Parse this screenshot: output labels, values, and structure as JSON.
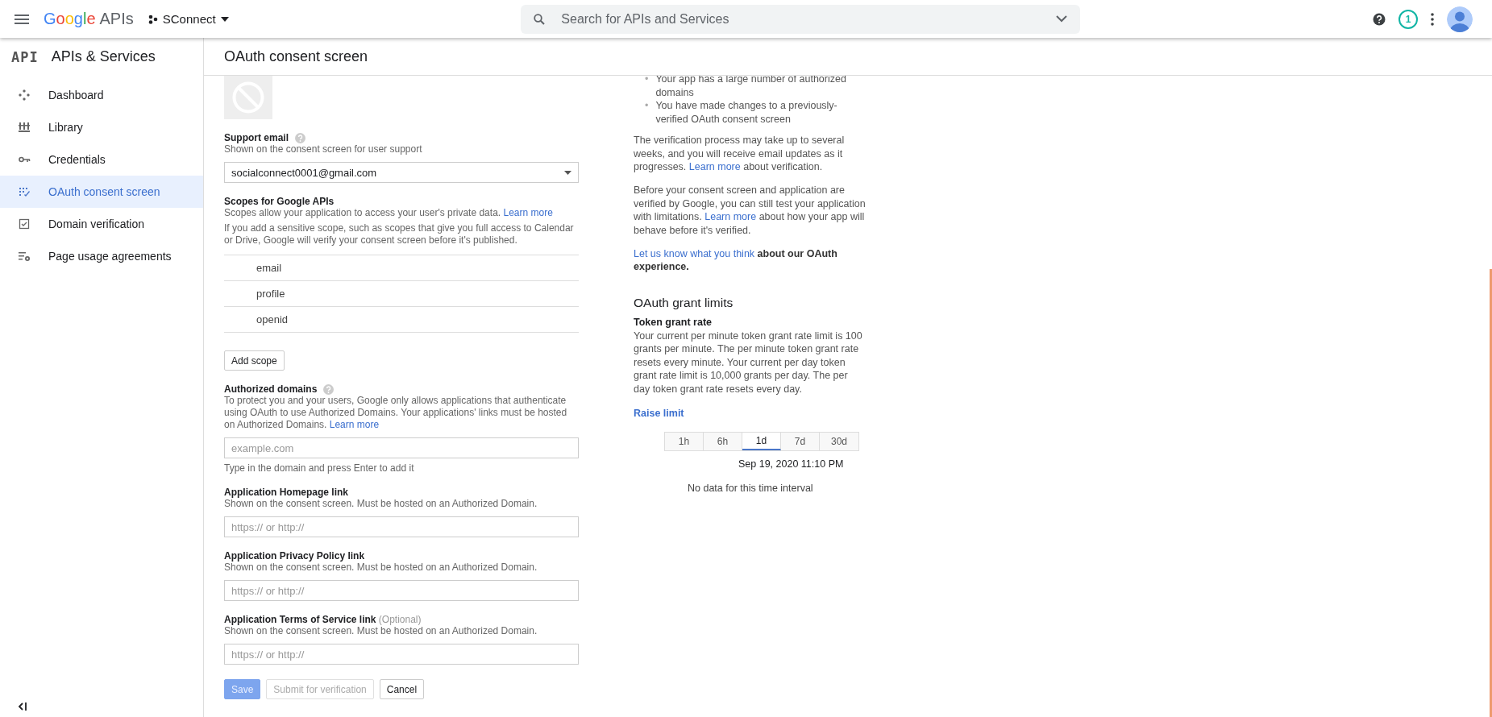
{
  "topbar": {
    "brand": "Google",
    "product": "APIs",
    "project": "SConnect",
    "search": {
      "placeholder": "Search for APIs and Services"
    },
    "notification_count": "1"
  },
  "sidebar": {
    "logo": "API",
    "title": "APIs & Services",
    "items": [
      {
        "label": "Dashboard",
        "selected": false
      },
      {
        "label": "Library",
        "selected": false
      },
      {
        "label": "Credentials",
        "selected": false
      },
      {
        "label": "OAuth consent screen",
        "selected": true
      },
      {
        "label": "Domain verification",
        "selected": false
      },
      {
        "label": "Page usage agreements",
        "selected": false
      }
    ]
  },
  "page_title": "OAuth consent screen",
  "form": {
    "support_email": {
      "label": "Support email",
      "description": "Shown on the consent screen for user support",
      "value": "socialconnect0001@gmail.com"
    },
    "scopes": {
      "title": "Scopes for Google APIs",
      "description": "Scopes allow your application to access your user's private data.",
      "link": "Learn more",
      "note": "If you add a sensitive scope, such as scopes that give you full access to Calendar or Drive, Google will verify your consent screen before it's published.",
      "items": [
        "email",
        "profile",
        "openid"
      ],
      "add_button": "Add scope"
    },
    "authorized_domains": {
      "title": "Authorized domains",
      "description": "To protect you and your users, Google only allows applications that authenticate using OAuth to use Authorized Domains. Your applications' links must be hosted on Authorized Domains.",
      "link": "Learn more",
      "placeholder": "example.com",
      "hint": "Type in the domain and press Enter to add it"
    },
    "links": [
      {
        "label": "Application Homepage link",
        "description": "Shown on the consent screen. Must be hosted on an Authorized Domain.",
        "placeholder": "https:// or http://"
      },
      {
        "label": "Application Privacy Policy link",
        "description": "Shown on the consent screen. Must be hosted on an Authorized Domain.",
        "placeholder": "https:// or http://"
      },
      {
        "label": "Application Terms of Service link",
        "optional": "(Optional)",
        "description": "Shown on the consent screen. Must be hosted on an Authorized Domain.",
        "placeholder": "https:// or http://"
      }
    ],
    "buttons": [
      {
        "label": "Save",
        "kind": "primary",
        "disabled": true
      },
      {
        "label": "Submit for verification",
        "kind": "secondary",
        "disabled": true
      },
      {
        "label": "Cancel",
        "kind": "secondary",
        "disabled": false
      }
    ]
  },
  "info": {
    "bullets": [
      {
        "marker": "•",
        "text": "Your app has a large number of authorized domains"
      },
      {
        "marker": "•",
        "text": "You have made changes to a previously-verified OAuth consent screen"
      }
    ],
    "paragraphs": [
      [
        {
          "kind": "text",
          "text": "The verification process may take up to several weeks, and you will receive email updates as it progresses. "
        },
        {
          "kind": "link",
          "text": "Learn more"
        },
        {
          "kind": "text",
          "text": " about verification."
        }
      ],
      [
        {
          "kind": "text",
          "text": "Before your consent screen and application are verified by Google, you can still test your application with limitations. "
        },
        {
          "kind": "link",
          "text": "Learn more"
        },
        {
          "kind": "text",
          "text": " about how your app will behave before it's verified."
        }
      ],
      [
        {
          "kind": "link",
          "text": "Let us know what you think"
        },
        {
          "kind": "bold",
          "text": " about our OAuth experience."
        }
      ]
    ],
    "grant_limits": {
      "title": "OAuth grant limits",
      "subtitle": "Token grant rate",
      "description": "Your current per minute token grant rate limit is 100 grants per minute. The per minute token grant rate resets every minute. Your current per day token grant rate limit is 10,000 grants per day. The per day token grant rate resets every day.",
      "raise_link": "Raise limit",
      "ranges": [
        {
          "label": "1h",
          "selected": false
        },
        {
          "label": "6h",
          "selected": false
        },
        {
          "label": "1d",
          "selected": true
        },
        {
          "label": "7d",
          "selected": false
        },
        {
          "label": "30d",
          "selected": false
        }
      ],
      "timestamp": "Sep 19, 2020 11:10 PM",
      "empty_message": "No data for this time interval"
    }
  }
}
